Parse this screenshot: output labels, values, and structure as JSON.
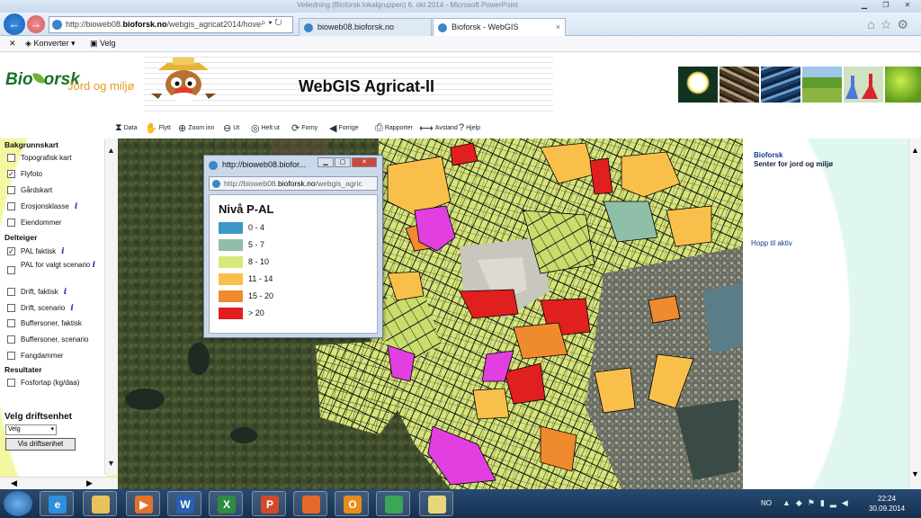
{
  "window": {
    "title_faded": "Veiledning (Bioforsk lokalgruppen) 6. okt 2014 - Microsoft PowerPoint"
  },
  "browser": {
    "url_prefix": "http://bioweb08.",
    "url_domain": "bioforsk.no",
    "url_suffix": "/webgis_agricat2014/hove",
    "tabs": [
      {
        "label": "bioweb08.bioforsk.no"
      },
      {
        "label": "Bioforsk - WebGIS"
      }
    ],
    "tab_close": "×",
    "favorites": [
      {
        "label": "Konverter"
      },
      {
        "label": "Velg"
      }
    ]
  },
  "header": {
    "logo_text_a": "Bio",
    "logo_text_b": "orsk",
    "logo_sub": "Jord og miljø",
    "app_title": "WebGIS Agricat-II"
  },
  "toolbar": {
    "tools": [
      {
        "label": "Data",
        "icon": "binoculars-icon"
      },
      {
        "label": "Flytt",
        "icon": "hand-icon"
      },
      {
        "label": "Zoom inn",
        "icon": "zoom-in-icon"
      },
      {
        "label": "Ut",
        "icon": "zoom-out-icon"
      },
      {
        "label": "Helt ut",
        "icon": "full-extent-icon"
      },
      {
        "label": "Forny",
        "icon": "refresh-icon"
      },
      {
        "label": "Forrige",
        "icon": "previous-icon"
      },
      {
        "label": "Rapporter",
        "icon": "printer-icon"
      },
      {
        "label": "Avstand",
        "icon": "ruler-icon"
      },
      {
        "label": "Hjelp",
        "icon": "help-icon"
      }
    ]
  },
  "sidebar": {
    "sections": {
      "bakgrunn": "Bakgrunnskart",
      "delteiger": "Delteiger",
      "resultater": "Resultater"
    },
    "layers": [
      {
        "label": "Topografisk kart",
        "checked": false,
        "info": ""
      },
      {
        "label": "Flyfoto",
        "checked": true,
        "info": ""
      },
      {
        "label": "Gårdskart",
        "checked": false,
        "info": ""
      },
      {
        "label": "Erosjonsklasse",
        "checked": false,
        "info": "i"
      },
      {
        "label": "Eiendommer",
        "checked": false,
        "info": ""
      },
      {
        "label": "PAL faktisk",
        "checked": true,
        "info": "i"
      },
      {
        "label": "PAL for valgt scenario",
        "checked": false,
        "info": "i"
      },
      {
        "label": "Drift, faktisk",
        "checked": false,
        "info": "i"
      },
      {
        "label": "Drift, scenario",
        "checked": false,
        "info": "i"
      },
      {
        "label": "Buffersoner, faktisk",
        "checked": false,
        "info": ""
      },
      {
        "label": "Buffersoner, scenario",
        "checked": false,
        "info": ""
      },
      {
        "label": "Fangdammer",
        "checked": false,
        "info": ""
      },
      {
        "label": "Fosfortap (kg/daa)",
        "checked": false,
        "info": ""
      }
    ],
    "driftsenhet_heading": "Velg driftsenhet",
    "select_value": "Velg",
    "button_label": "Vis driftsenhet",
    "check_mark": "✓"
  },
  "rightpane": {
    "org": "Bioforsk",
    "org_sub": "Senter for jord og miljø",
    "skip_link": "Hopp til aktiv"
  },
  "popup": {
    "title": "http://bioweb08.biofor...",
    "url_prefix": "http://bioweb08.",
    "url_domain": "bioforsk.no",
    "url_suffix": "/webgis_agric",
    "legend_title": "Nivå P-AL",
    "legend": [
      {
        "label": "0 - 4",
        "color": "#3d97c8"
      },
      {
        "label": "5 - 7",
        "color": "#8fbfa8"
      },
      {
        "label": "8 - 10",
        "color": "#d7e97a"
      },
      {
        "label": "11 - 14",
        "color": "#f8c04b"
      },
      {
        "label": "15 - 20",
        "color": "#f08a2e"
      },
      {
        "label": "> 20",
        "color": "#e11f1f"
      }
    ]
  },
  "taskbar": {
    "lang": "NO",
    "time": "22:24",
    "date": "30.09.2014",
    "apps": [
      {
        "name": "internet-explorer",
        "glyph": "e",
        "color": "#2f8ede"
      },
      {
        "name": "file-explorer",
        "glyph": "",
        "color": "#e8c25a"
      },
      {
        "name": "media-player",
        "glyph": "▶",
        "color": "#e5722a"
      },
      {
        "name": "word",
        "glyph": "W",
        "color": "#2b5fb0"
      },
      {
        "name": "excel",
        "glyph": "X",
        "color": "#2f8a43"
      },
      {
        "name": "powerpoint",
        "glyph": "P",
        "color": "#d2492a"
      },
      {
        "name": "firefox",
        "glyph": "",
        "color": "#e4682a"
      },
      {
        "name": "outlook",
        "glyph": "O",
        "color": "#e88c1a"
      },
      {
        "name": "chrome",
        "glyph": "",
        "color": "#3aa757"
      },
      {
        "name": "folder-app",
        "glyph": "",
        "color": "#e8d47a"
      }
    ]
  }
}
